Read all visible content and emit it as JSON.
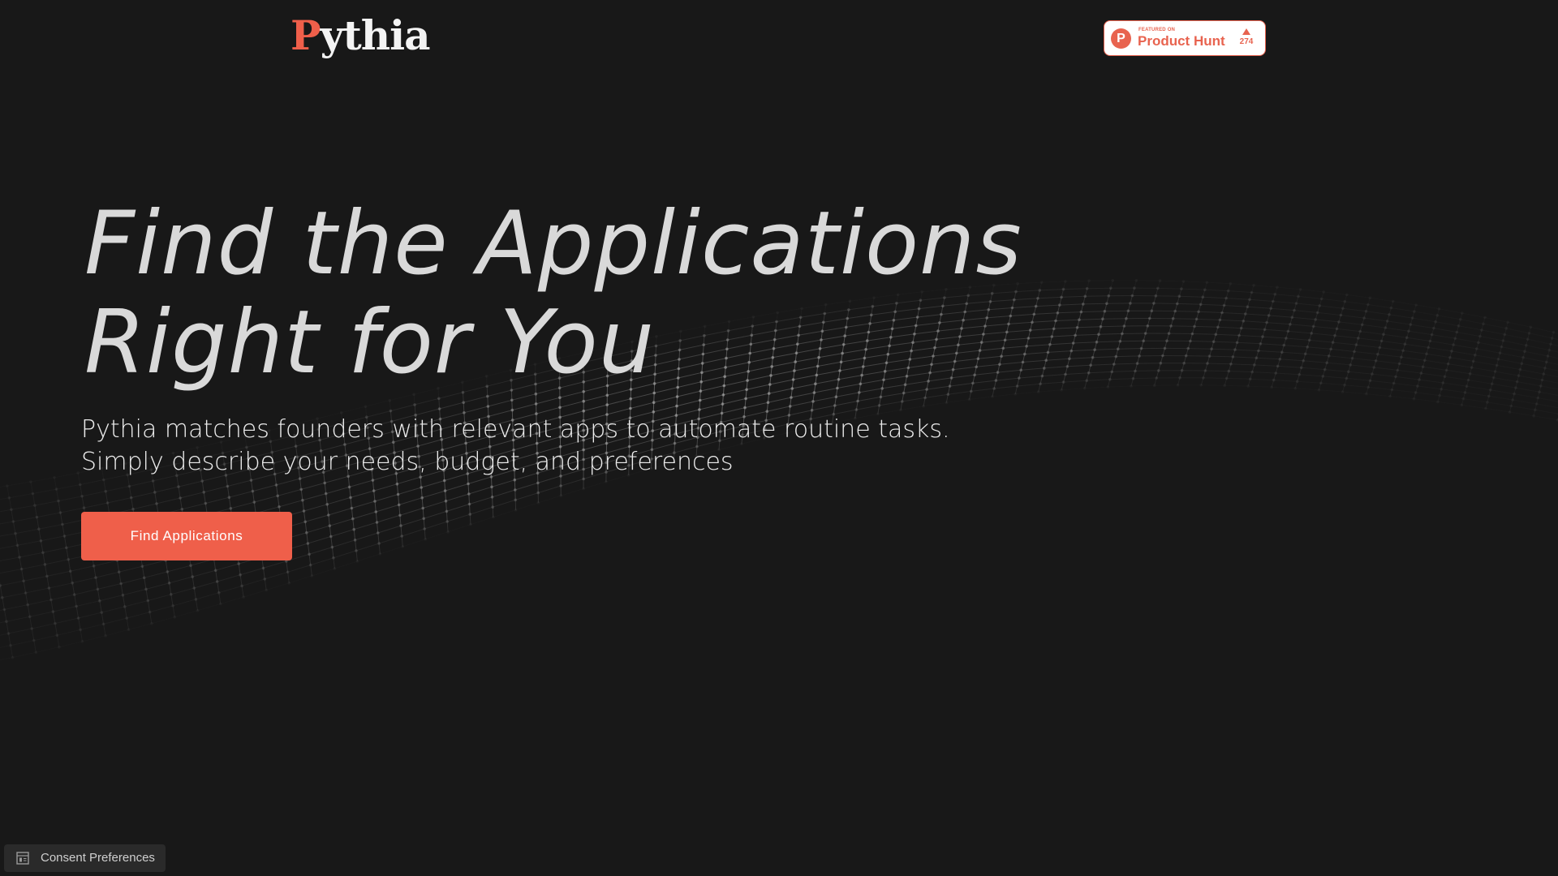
{
  "header": {
    "logo": {
      "initial": "P",
      "rest": "ythia"
    },
    "product_hunt_badge": {
      "featured_text": "FEATURED ON",
      "name": "Product Hunt",
      "icon_letter": "P",
      "upvotes": "274"
    }
  },
  "hero": {
    "title_lines": [
      "Find the Applications",
      "Right for You"
    ],
    "subtitle_lines": [
      "Pythia matches founders with relevant apps to automate routine tasks.",
      "Simply describe your needs, budget, and preferences"
    ],
    "cta_label": "Find Applications"
  },
  "footer": {
    "consent_label": "Consent Preferences"
  },
  "icons": {
    "product_hunt": "product-hunt-icon",
    "upvote": "upvote-arrow-icon",
    "consent": "consent-icon",
    "background": "particle-wave-graphic"
  },
  "colors": {
    "background": "#181818",
    "accent": "#ef5f4a",
    "title_text": "#d9d9d9",
    "body_text": "#ececec",
    "product_hunt": "#e8634f",
    "consent_bar": "#2a2a2a"
  }
}
